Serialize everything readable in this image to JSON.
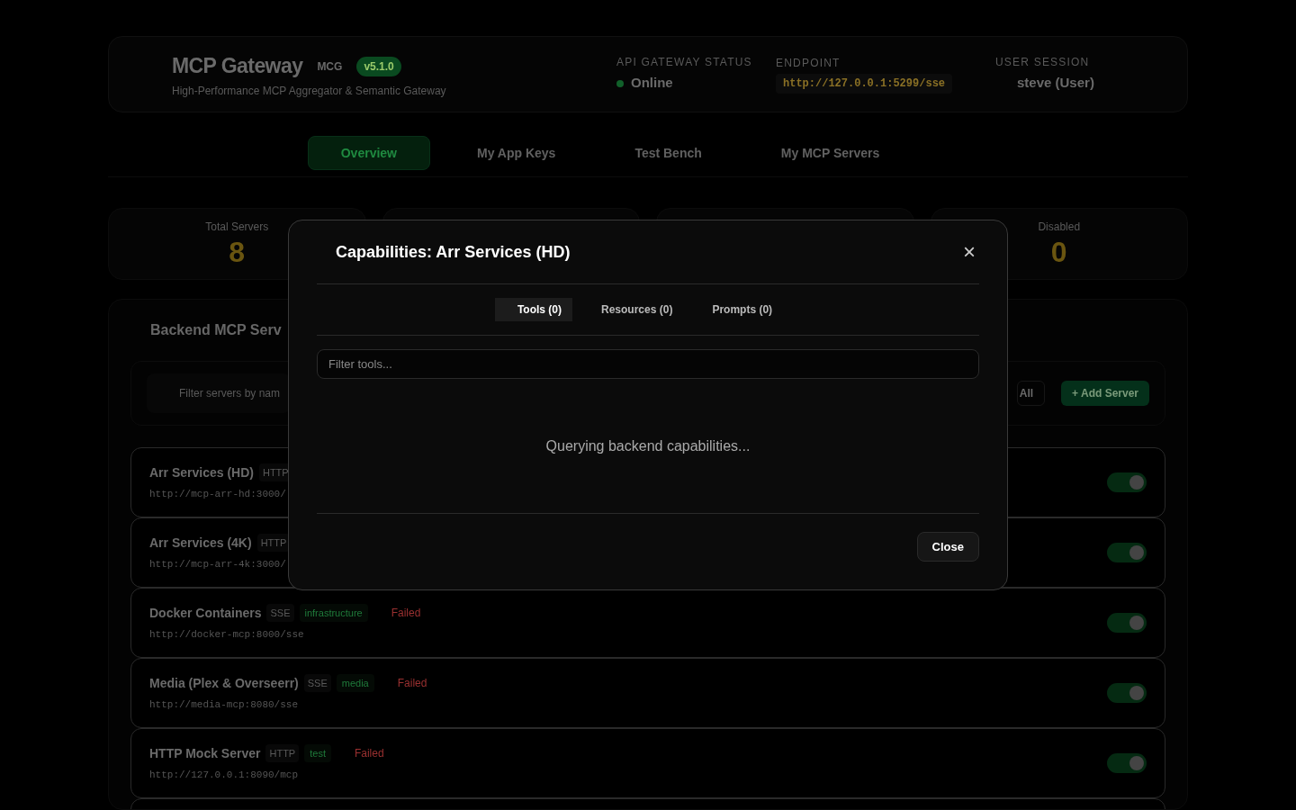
{
  "header": {
    "title": "MCP Gateway",
    "code": "MCG",
    "version": "v5.1.0",
    "subtitle": "High-Performance MCP Aggregator & Semantic Gateway",
    "status": {
      "label": "API GATEWAY STATUS",
      "value": "Online",
      "online": true
    },
    "endpoint": {
      "label": "ENDPOINT",
      "value": "http://127.0.0.1:5299/sse"
    },
    "session": {
      "label": "USER SESSION",
      "value": "steve (User)"
    }
  },
  "nav_tabs": [
    {
      "label": "Overview",
      "selected": true
    },
    {
      "label": "My App Keys",
      "selected": false
    },
    {
      "label": "Test Bench",
      "selected": false
    },
    {
      "label": "My MCP Servers",
      "selected": false
    }
  ],
  "stats": [
    {
      "label": "Total Servers",
      "value": "8"
    },
    {
      "label": "Disabled",
      "value": "0"
    }
  ],
  "servers_panel": {
    "title": "Backend MCP Serv",
    "filter": {
      "placeholder": "Filter servers by nam"
    },
    "buttons": [
      {
        "label": "All",
        "kind": "plain"
      },
      {
        "label": "+ Add Server",
        "kind": "primary"
      }
    ],
    "servers": [
      {
        "name": "Arr Services (HD)",
        "protocol": "HTTP",
        "url": "http://mcp-arr-hd:3000/",
        "enabled": true
      },
      {
        "name": "Arr Services (4K)",
        "protocol": "HTTP",
        "url": "http://mcp-arr-4k:3000/",
        "enabled": true
      },
      {
        "name": "Docker Containers",
        "protocol": "SSE",
        "tag": "infrastructure",
        "status": "Failed",
        "url": "http://docker-mcp:8000/sse",
        "enabled": true
      },
      {
        "name": "Media (Plex & Overseerr)",
        "protocol": "SSE",
        "tag": "media",
        "status": "Failed",
        "url": "http://media-mcp:8080/sse",
        "enabled": true
      },
      {
        "name": "HTTP Mock Server",
        "protocol": "HTTP",
        "tag": "test",
        "status": "Failed",
        "url": "http://127.0.0.1:8090/mcp",
        "enabled": true
      }
    ]
  },
  "modal": {
    "title": "Capabilities: Arr Services (HD)",
    "close_icon": "×",
    "tabs": [
      {
        "label": "Tools (0)",
        "selected": true
      },
      {
        "label": "Resources (0)",
        "selected": false
      },
      {
        "label": "Prompts (0)",
        "selected": false
      }
    ],
    "filter": {
      "placeholder": "Filter tools..."
    },
    "message": "Querying backend capabilities...",
    "close_button": "Close"
  }
}
